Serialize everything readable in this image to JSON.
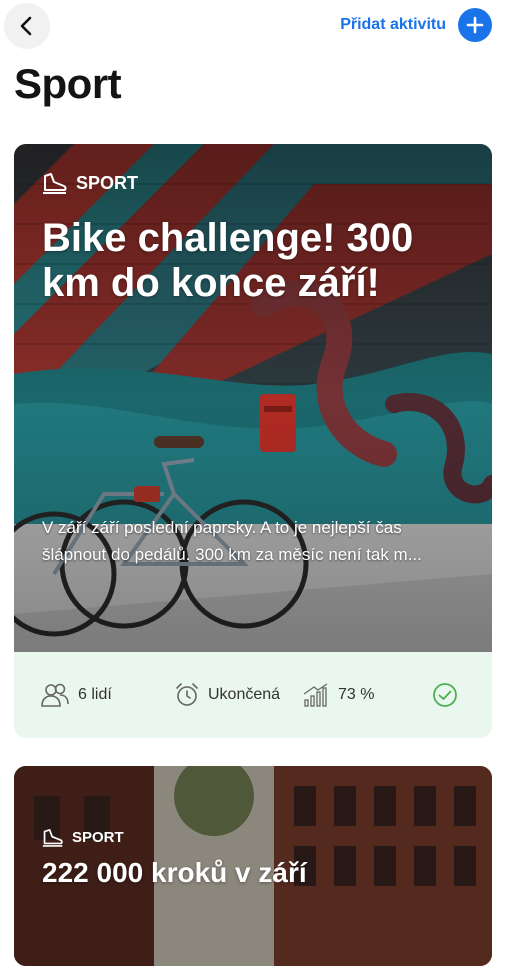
{
  "header": {
    "add_activity_label": "Přidat aktivitu",
    "page_title": "Sport"
  },
  "cards": [
    {
      "tag": "SPORT",
      "title": "Bike challenge! 300 km do konce září!",
      "description": "V září září poslední paprsky. A to je nejlepší čas šlápnout do pedálů. 300 km za měsíc není tak m...",
      "stats": {
        "people": "6 lidí",
        "status": "Ukončená",
        "progress": "73 %",
        "progress_value": 0.73
      }
    },
    {
      "tag": "SPORT",
      "title": "222 000 kroků v září"
    }
  ],
  "colors": {
    "accent": "#1a73e8",
    "success": "#4caf50",
    "stats_bg": "#eaf7ee"
  }
}
